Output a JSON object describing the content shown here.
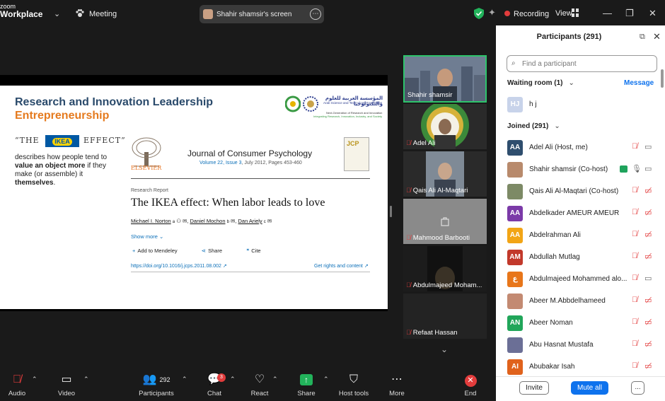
{
  "topbar": {
    "brand_small": "zoom",
    "brand": "Workplace",
    "meeting_label": "Meeting",
    "share_label": "Shahir shamsir's screen",
    "recording_label": "Recording",
    "view_label": "View"
  },
  "slide": {
    "title1": "Research and Innovation Leadership",
    "title2": "Entrepreneurship",
    "quote_open": "“THE",
    "ikea": "IKEA",
    "effect": "EFFECT”",
    "desc_1": "describes how people tend to ",
    "desc_bold1": "value an object more",
    "desc_2": " if they make (or assemble) it ",
    "desc_bold2": "themselves",
    "desc_3": ".",
    "logo_ar": "المؤسسة العربية للعلوم والتكنولوجيا",
    "logo_en": "Arab Science and Technology Foundation",
    "logo_tag1": "Next-Generation of Research and Innovation",
    "logo_tag2": "Integrating Research, Innovation, Industry, and Society",
    "publisher": "ELSEVIER",
    "journal": "Journal of Consumer Psychology",
    "volume": "Volume 22, Issue 3",
    "date_pages": ", July 2012, Pages 453-460",
    "jcp": "JCP",
    "report_type": "Research Report",
    "paper_title": "The IKEA effect: When labor leads to love",
    "author1": "Michael I. Norton",
    "author2": "Daniel Mochon",
    "author3": "Dan Ariely",
    "show_more": "Show more",
    "add_mendeley": "Add to Mendeley",
    "share": "Share",
    "cite": "Cite",
    "doi": "https://doi.org/10.1016/j.jcps.2011.08.002",
    "rights": "Get rights and content"
  },
  "tiles": [
    {
      "name": "Shahir shamsir"
    },
    {
      "name": "Adel Ali"
    },
    {
      "name": "Qais Ali Al-Maqtari"
    },
    {
      "name": "Mahmood Barbooti"
    },
    {
      "name": "Abdulmajeed Moham..."
    },
    {
      "name": "Refaat Hassan"
    }
  ],
  "panel": {
    "title": "Participants (291)",
    "search_placeholder": "Find a participant",
    "waiting_room": "Waiting room (1)",
    "message": "Message",
    "waiting": [
      {
        "initials": "HJ",
        "name": "h j",
        "color": "#c8d3ea"
      }
    ],
    "joined": "Joined (291)",
    "participants": [
      {
        "initials": "AA",
        "name": "Adel Ali (Host, me)",
        "color": "#2f4e6e"
      },
      {
        "initials": "",
        "name": "Shahir shamsir (Co-host)",
        "color": "#b88a6c"
      },
      {
        "initials": "",
        "name": "Qais Ali Al-Maqtari (Co-host)",
        "color": "#7d8a66"
      },
      {
        "initials": "AA",
        "name": "Abdelkader AMEUR AMEUR",
        "color": "#7b3aa8"
      },
      {
        "initials": "AA",
        "name": "Abdelrahman Ali",
        "color": "#f2a516"
      },
      {
        "initials": "AM",
        "name": "Abdullah Mutlag",
        "color": "#c2392b"
      },
      {
        "initials": "ع",
        "name": "Abdulmajeed Mohammed alo...",
        "color": "#e8761a"
      },
      {
        "initials": "",
        "name": "Abeer M.Abbdelhameed",
        "color": "#c38a72"
      },
      {
        "initials": "AN",
        "name": "Abeer Noman",
        "color": "#21a65a"
      },
      {
        "initials": "",
        "name": "Abu Hasnat Mustafa",
        "color": "#6b6f96"
      },
      {
        "initials": "AI",
        "name": "Abubakar Isah",
        "color": "#e0621c"
      }
    ],
    "invite": "Invite",
    "mute_all": "Mute all",
    "more": "..."
  },
  "toolbar": {
    "audio": "Audio",
    "video": "Video",
    "participants": "Participants",
    "participant_count": "292",
    "chat": "Chat",
    "chat_badge": "3",
    "react": "React",
    "share": "Share",
    "host_tools": "Host tools",
    "more": "More",
    "end": "End"
  }
}
